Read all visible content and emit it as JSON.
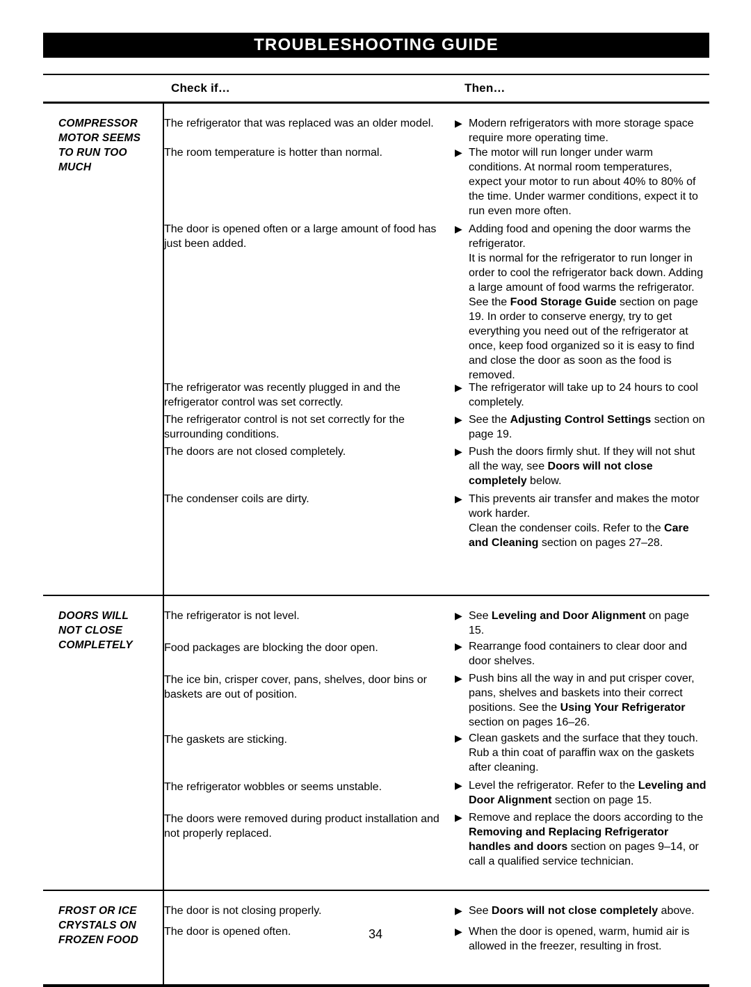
{
  "page": {
    "banner_title": "TROUBLESHOOTING GUIDE",
    "page_number": "34",
    "accent_color": "#000000",
    "background_color": "#ffffff"
  },
  "table": {
    "headers": {
      "cause": "",
      "check_if": "Check if…",
      "then": "Then…"
    },
    "bullet_icon": "▶",
    "sections": [
      {
        "title": "COMPRESSOR MOTOR SEEMS TO RUN TOO MUCH",
        "title_lines": [
          "COMPRESSOR",
          "MOTOR SEEMS",
          "TO RUN TOO",
          "MUCH"
        ],
        "check_if": [
          "The refrigerator that was replaced was an older model.",
          "The room temperature is hotter than normal.",
          "The door is opened often or a large amount of food has just been added.",
          "The refrigerator was recently plugged in and the refrigerator control was set correctly.",
          "The refrigerator control is not set correctly for the surrounding conditions.",
          "The doors are not closed completely.",
          "The condenser coils are dirty."
        ],
        "then": [
          {
            "text": "Modern refrigerators with more storage space require more operating time."
          },
          {
            "text": "The motor will run longer under warm conditions. At normal room temperatures, expect your motor to run about 40% to 80% of the time. Under warmer conditions, expect it to run even more often."
          },
          {
            "text": "Adding food and opening the door warms the refrigerator.",
            "continuation": "It is normal for the refrigerator to run longer in order to cool the refrigerator back down. Adding a large amount of food warms the refrigerator. See the |b:Food Storage Guide| section on page 19. In order to conserve energy, try to get everything you need out of the refrigerator at once, keep food organized so it is easy to find and close the door as soon as the food is removed."
          },
          {
            "text": "The refrigerator will take up to 24 hours to cool completely."
          },
          {
            "text": "See the |b:Adjusting Control Settings| section on page 19."
          },
          {
            "text": "Push the doors firmly shut. If they will not shut all the way, see |b:Doors will not close completely| below."
          },
          {
            "text": "This prevents air transfer and makes the motor work harder.",
            "continuation": "Clean the condenser coils. Refer to the |b:Care and Cleaning| section on pages 27–28."
          }
        ]
      },
      {
        "title": "DOORS WILL NOT CLOSE COMPLETELY",
        "title_lines": [
          "DOORS WILL",
          "NOT CLOSE",
          "COMPLETELY"
        ],
        "check_if": [
          "The refrigerator is not level.",
          "Food packages are blocking the door open.",
          "The ice bin, crisper cover, pans, shelves, door bins or baskets are out of position.",
          "The gaskets are sticking.",
          "The refrigerator wobbles or seems unstable.",
          "The doors were removed during product installation and not properly replaced."
        ],
        "then": [
          {
            "text": "See |b:Leveling and Door Alignment| on page 15."
          },
          {
            "text": "Rearrange food containers to clear door and door shelves."
          },
          {
            "text": "Push bins all the way in and put crisper cover, pans, shelves and baskets into their correct positions. See the |b:Using Your Refrigerator| section on pages 16–26."
          },
          {
            "text": "Clean gaskets and the surface that they touch. Rub a thin coat of paraffin wax on the gaskets after cleaning."
          },
          {
            "text": "Level the refrigerator. Refer to the |b:Leveling and Door Alignment| section on page 15."
          },
          {
            "text": "Remove and replace the doors according to the |b:Removing and Replacing Refrigerator handles and doors| section on pages 9–14, or call a qualified service technician."
          }
        ]
      },
      {
        "title": "FROST OR ICE CRYSTALS ON FROZEN FOOD",
        "title_lines": [
          "FROST OR ICE",
          "CRYSTALS ON",
          "FROZEN FOOD"
        ],
        "check_if": [
          "The door is not closing properly.",
          "The door is opened often."
        ],
        "then": [
          {
            "text": "See |b:Doors will not close completely| above."
          },
          {
            "text": "When the door is opened, warm, humid air is allowed in the freezer, resulting in frost."
          }
        ]
      }
    ]
  }
}
